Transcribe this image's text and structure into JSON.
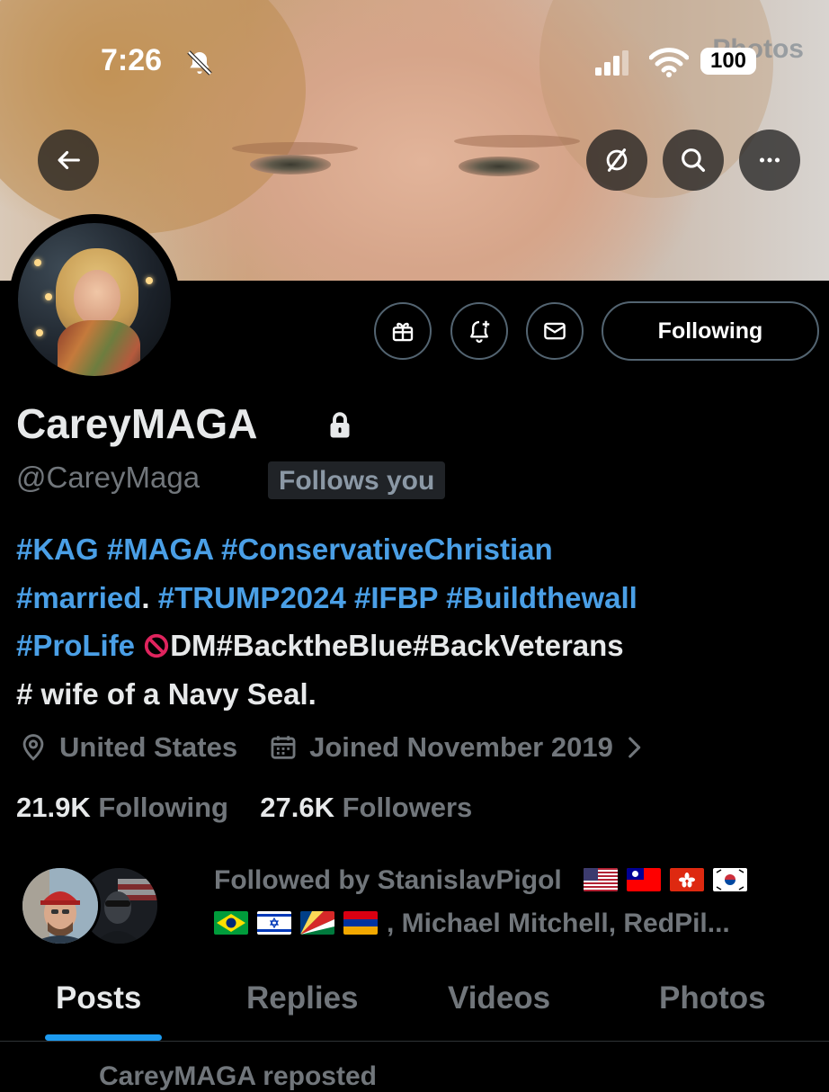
{
  "status_bar": {
    "time": "7:26",
    "battery": "100"
  },
  "banner": {
    "background_text": "Photos"
  },
  "header_actions": {
    "back_icon": "arrow-left-icon",
    "grok_icon": "slash-circle-icon",
    "search_icon": "search-icon",
    "more_icon": "more-icon"
  },
  "profile_actions": {
    "gift_icon": "gift-icon",
    "notify_icon": "bell-plus-icon",
    "message_icon": "envelope-icon",
    "following_label": "Following"
  },
  "profile": {
    "display_name": "CareyMAGA",
    "handle": "@CareyMaga",
    "follows_you": "Follows you",
    "location": "United States",
    "joined": "Joined November 2019",
    "following_count": "21.9K",
    "following_label": "Following",
    "followers_count": "27.6K",
    "followers_label": "Followers"
  },
  "bio": {
    "line1": [
      "#KAG",
      "#MAGA",
      "#ConservativeChristian"
    ],
    "line2_a": "#married",
    "line2_dot": ".",
    "line2_b": [
      "#TRUMP2024",
      "#IFBP",
      "#Buildthewall"
    ],
    "line3_tag": "#ProLife",
    "line3_text": "DM",
    "line3_tags": [
      "#BacktheBlue",
      "#BackVeterans"
    ],
    "line4": "# wife of a Navy Seal."
  },
  "followed_by": {
    "prefix": "Followed by StanislavPigol",
    "suffix": ", Michael Mitchell, RedPil..."
  },
  "tabs": [
    "Posts",
    "Replies",
    "Videos",
    "Photos"
  ],
  "active_tab": "Posts",
  "peek": "CareyMAGA reposted",
  "colors": {
    "accent": "#1d9bf0",
    "hashtag": "#4a9fe6",
    "muted": "#71767b",
    "text": "#e7e9ea",
    "background": "#000000"
  }
}
